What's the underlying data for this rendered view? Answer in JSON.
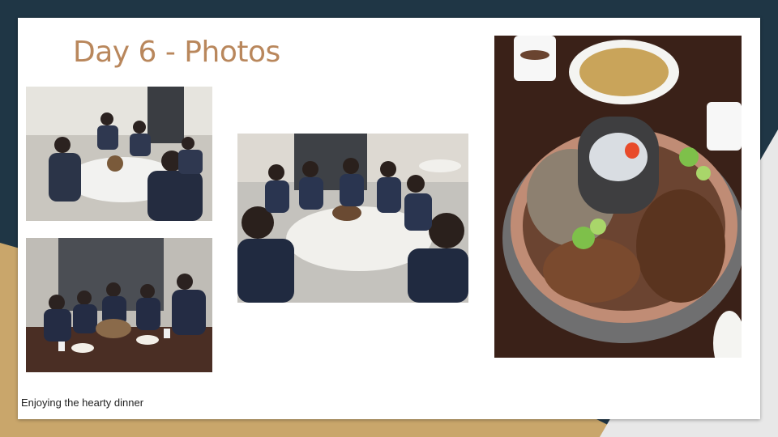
{
  "slide": {
    "title": "Day 6 - Photos",
    "caption": "Enjoying the hearty dinner"
  },
  "photos": [
    {
      "name": "group-photo-dining-table"
    },
    {
      "name": "group-photo-hotpot-table"
    },
    {
      "name": "group-selfie-round-table"
    },
    {
      "name": "mutton-hotpot-closeup"
    }
  ],
  "colors": {
    "title": "#b9875c",
    "background_dark": "#1f3645",
    "background_gold": "#c9a66b",
    "background_light": "#e8e8e8"
  }
}
